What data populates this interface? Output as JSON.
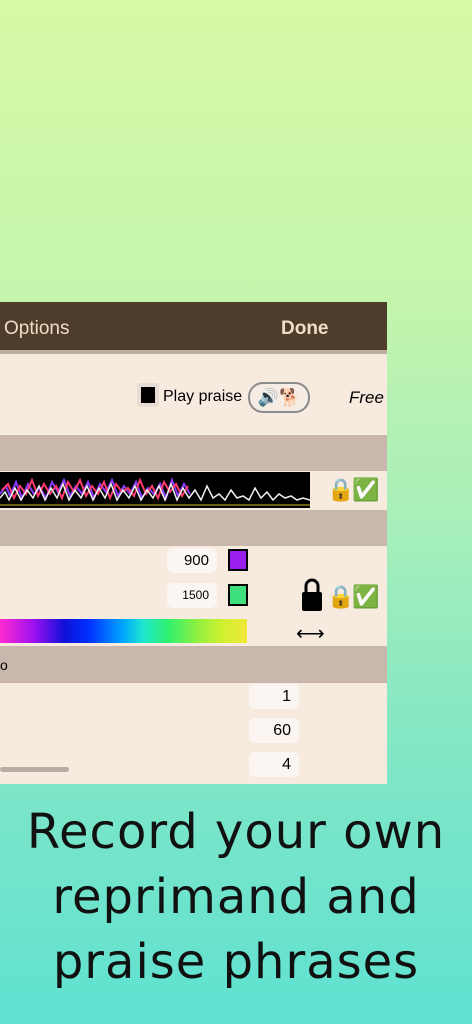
{
  "navbar": {
    "title": "Options",
    "done_label": "Done"
  },
  "praise_row": {
    "checkbox_checked": true,
    "label": "Play praise",
    "toggle_icons": "🔊🐕",
    "free_label": "Free"
  },
  "waveform_row": {
    "lock_icon": "🔒",
    "check_icon": "✅"
  },
  "frequency_rows": [
    {
      "value": "900",
      "color": "#9b1ef0"
    },
    {
      "value": "1500",
      "color": "#3ee07e"
    }
  ],
  "lock_controls": {
    "lock_icon": "🔒",
    "check_icon": "✅",
    "range_arrow": "⟷"
  },
  "section_fragment": "o",
  "settings_values": [
    "1",
    "60",
    "4"
  ],
  "caption": {
    "line1": "Record your own",
    "line2": "reprimand and",
    "line3": "praise phrases"
  }
}
